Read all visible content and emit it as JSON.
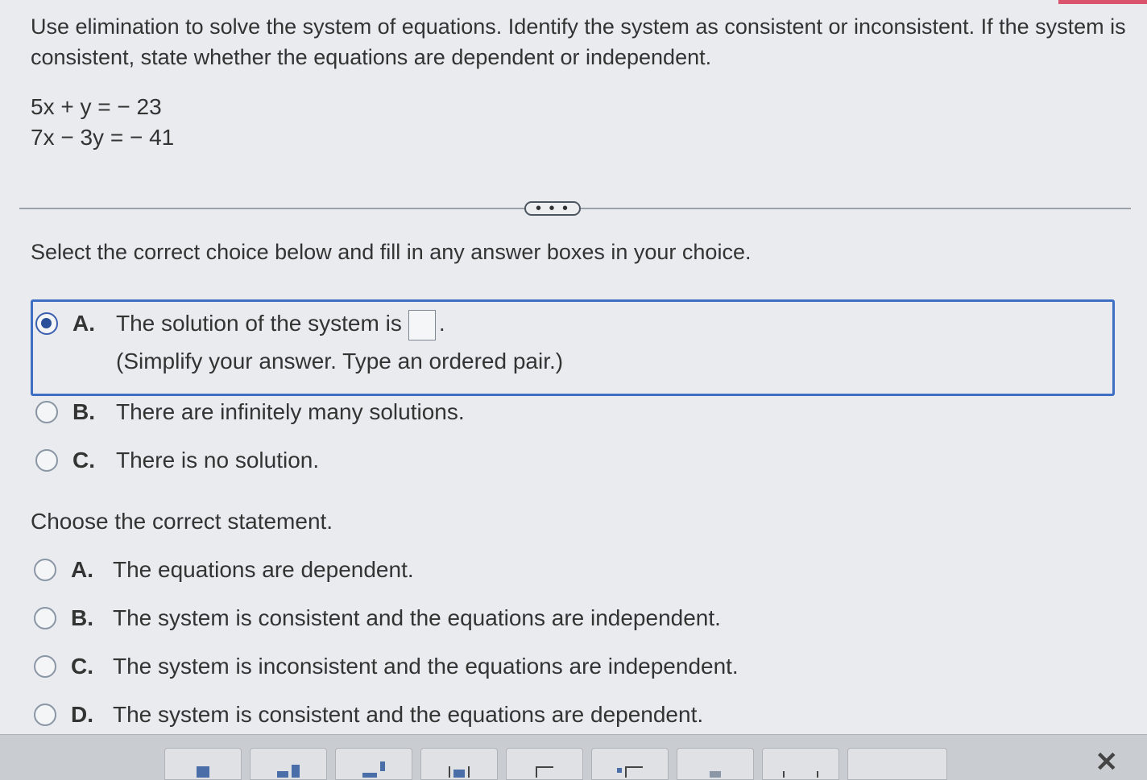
{
  "question": {
    "prompt": "Use elimination to solve the system of equations. Identify the system as consistent or inconsistent. If the system is consistent, state whether the equations are dependent or independent.",
    "equations": [
      "5x + y = − 23",
      "7x − 3y = − 41"
    ]
  },
  "more_button_label": "• • •",
  "part1": {
    "instruction": "Select the correct choice below and fill in any answer boxes in your choice.",
    "options": [
      {
        "letter": "A.",
        "text_before": "The solution of the system is",
        "text_after": ".",
        "hint": "(Simplify your answer. Type an ordered pair.)",
        "selected": true
      },
      {
        "letter": "B.",
        "text": "There are infinitely many solutions.",
        "selected": false
      },
      {
        "letter": "C.",
        "text": "There is no solution.",
        "selected": false
      }
    ]
  },
  "part2": {
    "title": "Choose the correct statement.",
    "options": [
      {
        "letter": "A.",
        "text": "The equations are dependent.",
        "selected": false
      },
      {
        "letter": "B.",
        "text": "The system is consistent and the equations are independent.",
        "selected": false
      },
      {
        "letter": "C.",
        "text": "The system is inconsistent and the equations are independent.",
        "selected": false
      },
      {
        "letter": "D.",
        "text": "The system is consistent and the equations are dependent.",
        "selected": false
      }
    ]
  },
  "toolbar": {
    "tools": [
      "fraction-icon",
      "mixed-number-icon",
      "exponent-icon",
      "absolute-value-icon",
      "square-root-icon",
      "nth-root-icon",
      "decimal-icon",
      "ordered-pair-icon",
      "more-tools-icon"
    ],
    "close_symbol": "✕"
  },
  "colors": {
    "accent": "#3f6fc4",
    "selected_radio": "#2a4f9a",
    "top_bar": "#d9546a"
  }
}
